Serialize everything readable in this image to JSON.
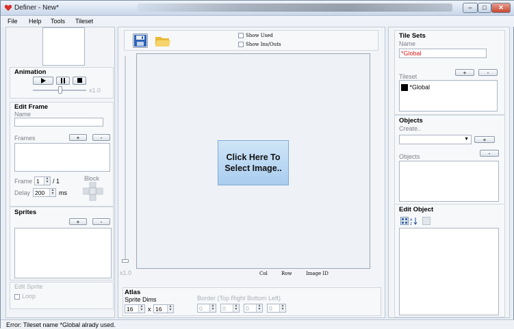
{
  "window": {
    "title": "Definer - New*",
    "controls": {
      "minimize": "–",
      "maximize": "□",
      "close": "✕"
    }
  },
  "menu": [
    "File",
    "Help",
    "Tools",
    "Tileset"
  ],
  "animation": {
    "heading": "Animation",
    "speed_label": "x1.0"
  },
  "edit_frame": {
    "heading": "Edit Frame",
    "name_label": "Name",
    "name_value": "",
    "frames_label": "Frames",
    "frame_label": "Frame",
    "frame_value": "1",
    "frame_total": "/ 1",
    "delay_label": "Delay",
    "delay_value": "200",
    "delay_unit": "ms",
    "block_label": "Block"
  },
  "sprites": {
    "heading": "Sprites"
  },
  "edit_sprite": {
    "heading": "Edit Sprite",
    "loop_label": "Loop"
  },
  "toolbar": {
    "show_used": "Show Used",
    "show_inouts": "Show Ins/Outs"
  },
  "canvas": {
    "placeholder": "Click Here To Select Image..",
    "zoom_label": "x1.0",
    "col_label": "Col",
    "row_label": "Row",
    "image_id_label": "Image ID"
  },
  "atlas": {
    "heading": "Atlas",
    "sprite_dims_label": "Sprite Dims",
    "width_value": "16",
    "times": "x",
    "height_value": "16",
    "border_label": "Border (Top Right Bottom Left)",
    "border_values": [
      "0",
      "0",
      "0",
      "0"
    ]
  },
  "tile_sets": {
    "heading": "Tile Sets",
    "name_label": "Name",
    "name_value": "*Global",
    "tileset_label": "Tileset",
    "tilesets": [
      {
        "name": "*Global",
        "color": "#000000"
      }
    ]
  },
  "objects": {
    "heading": "Objects",
    "create_label": "Create..",
    "objects_label": "Objects"
  },
  "edit_object": {
    "heading": "Edit Object"
  },
  "status": {
    "text": "Error: Tileset name *Global alrady used."
  },
  "colors": {
    "accent_red": "#d81b1b",
    "canvas_bg": "#eef1f5",
    "placeholder_bg": "#b7d7f2"
  },
  "icons": {
    "save": "floppy-disk-icon",
    "open": "folder-icon",
    "play": "play-icon",
    "pause": "pause-icon",
    "stop": "stop-icon"
  }
}
